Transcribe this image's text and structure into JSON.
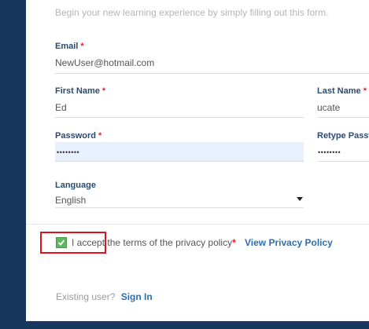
{
  "form": {
    "intro": "Begin your new learning experience by simply filling out this form.",
    "email": {
      "label": "Email",
      "required": "*",
      "value": "NewUser@hotmail.com"
    },
    "first_name": {
      "label": "First Name",
      "required": "*",
      "value": "Ed"
    },
    "last_name": {
      "label": "Last Name",
      "required": "*",
      "value": "ucate"
    },
    "password": {
      "label": "Password",
      "required": "*",
      "value": "••••••••"
    },
    "retype_password": {
      "label": "Retype Passw",
      "value": "••••••••"
    },
    "language": {
      "label": "Language",
      "value": "English"
    },
    "privacy": {
      "checked": true,
      "text": "I accept the terms of the privacy policy",
      "required": "*",
      "link": "View Privacy Policy"
    },
    "existing_user": {
      "text": "Existing user?",
      "link": "Sign In"
    }
  },
  "colors": {
    "frame": "#17375e",
    "label": "#2b4a6f",
    "required": "#d9262b",
    "link": "#2c6fb5",
    "checkbox": "#5cb85c",
    "autofill": "#e8f0fe",
    "highlight": "#e0121b"
  }
}
